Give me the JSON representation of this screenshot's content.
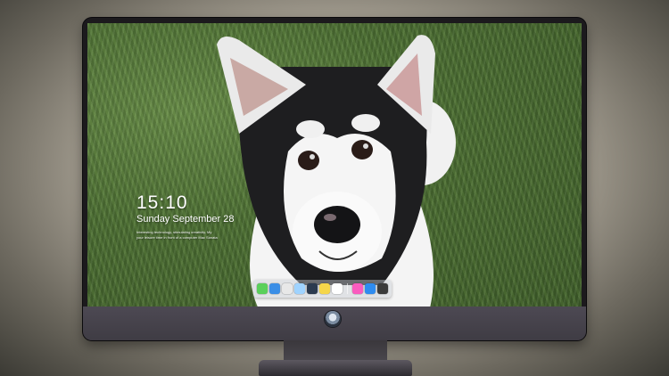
{
  "lockscreen": {
    "time": "15:10",
    "date": "Sunday September 28",
    "caption_line1": "Interesting technology, stimulating creativity. My",
    "caption_line2": "your leisure time in front of a computer Mac Sonata"
  },
  "dock": {
    "items": [
      {
        "name": "messages-icon",
        "color": "#5ad05a"
      },
      {
        "name": "finder-icon",
        "color": "#3a8ee6"
      },
      {
        "name": "safari-icon",
        "color": "#e8e8e8"
      },
      {
        "name": "preview-icon",
        "color": "#9fd3ff"
      },
      {
        "name": "video-editor-icon",
        "color": "#2b3a4f"
      },
      {
        "name": "notes-icon",
        "color": "#f5d64a"
      },
      {
        "name": "photos-icon",
        "color": "#ffffff"
      }
    ],
    "items_right": [
      {
        "name": "music-icon",
        "color": "#fa5cbf"
      },
      {
        "name": "app-store-icon",
        "color": "#2f8cf0"
      },
      {
        "name": "camera-icon",
        "color": "#3b3b3b"
      }
    ]
  }
}
